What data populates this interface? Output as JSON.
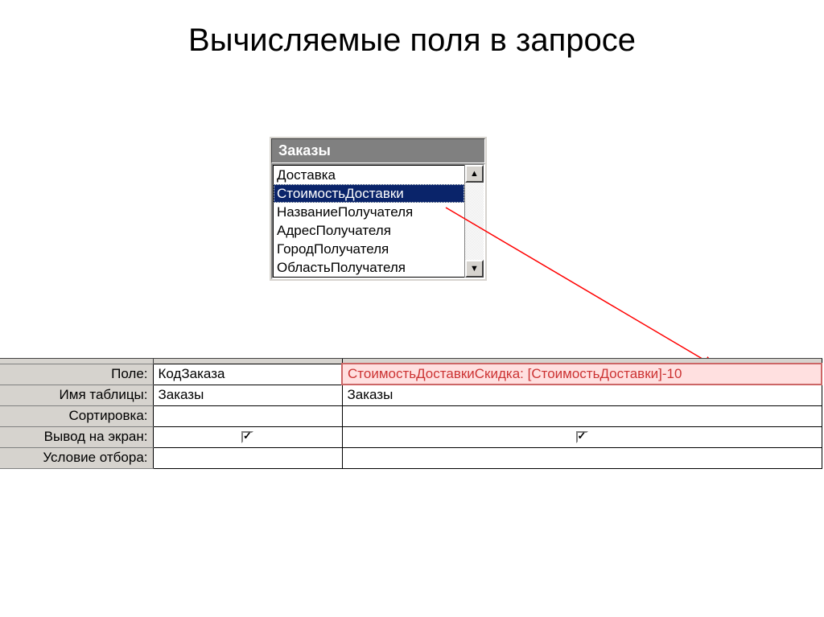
{
  "title": "Вычисляемые поля в запросе",
  "table_pane": {
    "title": "Заказы",
    "fields": [
      "Доставка",
      "СтоимостьДоставки",
      "НазваниеПолучателя",
      "АдресПолучателя",
      "ГородПолучателя",
      "ОбластьПолучателя"
    ],
    "selected_index": 1
  },
  "grid": {
    "rows": {
      "field": "Поле:",
      "table": "Имя таблицы:",
      "sort": "Сортировка:",
      "show": "Вывод на экран:",
      "criteria": "Условие отбора:"
    },
    "cols": [
      {
        "field": "КодЗаказа",
        "table": "Заказы",
        "sort": "",
        "show": true,
        "criteria": ""
      },
      {
        "field": "СтоимостьДоставкиСкидка: [СтоимостьДоставки]-10",
        "table": "Заказы",
        "sort": "",
        "show": true,
        "criteria": "",
        "highlight": true
      }
    ]
  }
}
